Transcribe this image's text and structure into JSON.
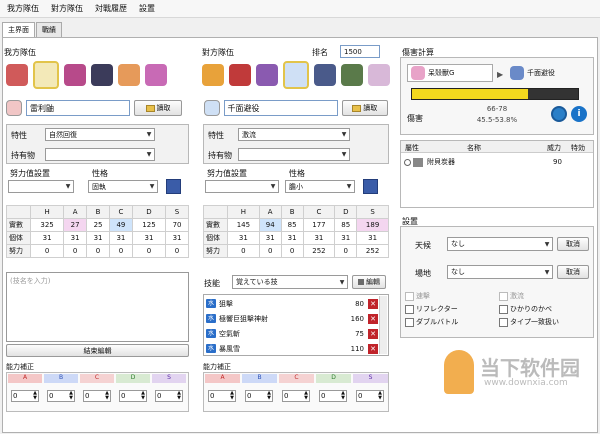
{
  "menu": [
    "我方隊伍",
    "對方隊伍",
    "対戰履歴",
    "設置"
  ],
  "tabs": [
    "主界面",
    "戰績"
  ],
  "left": {
    "team_label": "我方隊伍",
    "name": "雷利鼬",
    "load_label": "讀取",
    "ability_label": "特性",
    "ability": "自然回復",
    "item_label": "持有物",
    "item": "",
    "ev_label": "努力值設置",
    "nature_label": "性格",
    "nature": "固執",
    "stats_header": [
      "H",
      "A",
      "B",
      "C",
      "D",
      "S"
    ],
    "rows": [
      {
        "label": "實數",
        "values": [
          "325",
          "27",
          "25",
          "49",
          "125",
          "70"
        ]
      },
      {
        "label": "個体",
        "values": [
          "31",
          "31",
          "31",
          "31",
          "31",
          "31"
        ]
      },
      {
        "label": "努力",
        "values": [
          "0",
          "0",
          "0",
          "0",
          "0",
          "0"
        ]
      }
    ],
    "move_placeholder": "(技名を入力)",
    "finish_label": "結束編輯",
    "rank_label": "能力補正",
    "rank_stats": [
      "A",
      "B",
      "C",
      "D",
      "S"
    ],
    "rank_values": [
      "0",
      "0",
      "0",
      "0",
      "0"
    ],
    "rank_colors": [
      "#f4c7c7",
      "#cdd9f7",
      "#f5d2d2",
      "#d8ead2",
      "#e2d4f0"
    ]
  },
  "right": {
    "team_label": "對方隊伍",
    "rank_order_label": "排名",
    "rank_order": "1500",
    "name": "千面避役",
    "load_label": "讀取",
    "ability_label": "特性",
    "ability": "激流",
    "item_label": "持有物",
    "item": "",
    "ev_label": "努力值設置",
    "nature_label": "性格",
    "nature": "膽小",
    "stats_header": [
      "H",
      "A",
      "B",
      "C",
      "D",
      "S"
    ],
    "rows": [
      {
        "label": "實數",
        "values": [
          "145",
          "94",
          "85",
          "177",
          "85",
          "189"
        ]
      },
      {
        "label": "個体",
        "values": [
          "31",
          "31",
          "31",
          "31",
          "31",
          "31"
        ]
      },
      {
        "label": "努力",
        "values": [
          "0",
          "0",
          "0",
          "252",
          "0",
          "252"
        ]
      }
    ],
    "moves_label": "技能",
    "moves_select": "覚えている技",
    "edit_label": "編輯",
    "moves": [
      {
        "type": "水",
        "name": "狙擊",
        "power": "80"
      },
      {
        "type": "水",
        "name": "極響巨狙擊神射",
        "power": "160"
      },
      {
        "type": "水",
        "name": "空氣斬",
        "power": "75"
      },
      {
        "type": "水",
        "name": "暴風雪",
        "power": "110"
      }
    ],
    "rank_label": "能力補正",
    "rank_stats": [
      "A",
      "B",
      "C",
      "D",
      "S"
    ],
    "rank_values": [
      "0",
      "0",
      "0",
      "0",
      "0"
    ]
  },
  "damage": {
    "title": "傷害計算",
    "attacker": "呆殼獸G",
    "defender": "千面避役",
    "bar_fill": 0.7,
    "range": "66-78",
    "percent": "45.5-53.8%",
    "label": "傷害",
    "headers": [
      "屬性",
      "名称",
      "威力",
      "特効"
    ],
    "row": {
      "name": "附貝炭器",
      "power": "90"
    }
  },
  "settings": {
    "title": "設置",
    "weather_label": "天候",
    "weather": "なし",
    "field_label": "場地",
    "field": "なし",
    "cancel_label": "取消",
    "checks": [
      "速擊",
      "激流",
      "リフレクター",
      "ひかりのかべ",
      "ダブルバトル",
      "タイプ一致扱い"
    ],
    "checks_disabled": [
      true,
      true,
      false,
      false,
      false,
      false
    ]
  },
  "watermark": {
    "title": "当下软件园",
    "url": "www.downxia.com"
  }
}
